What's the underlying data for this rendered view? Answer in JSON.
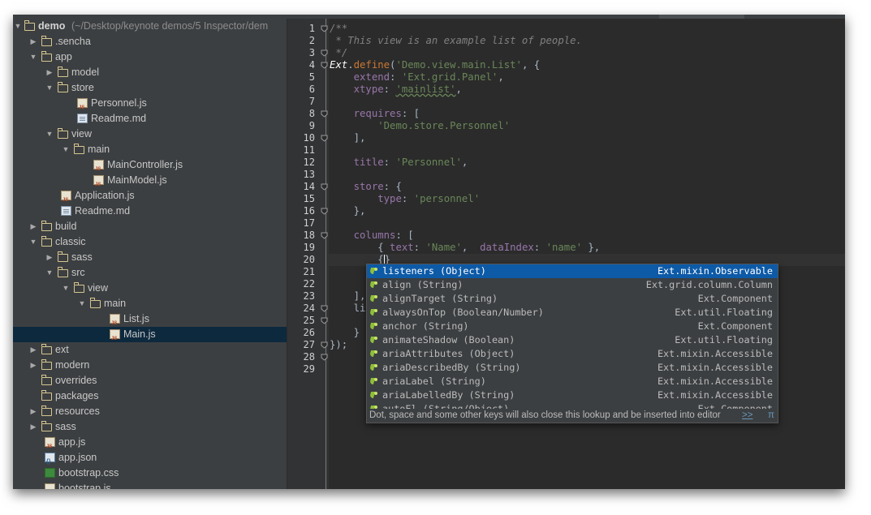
{
  "tree": {
    "root": {
      "name": "demo",
      "path": "(~/Desktop/keynote demos/5 Inspector/dem"
    },
    "items": [
      {
        "label": ".sencha",
        "type": "folder",
        "expanded": false
      },
      {
        "label": "app",
        "type": "folder",
        "expanded": true
      },
      {
        "label": "model",
        "type": "folder",
        "expanded": false
      },
      {
        "label": "store",
        "type": "folder",
        "expanded": true
      },
      {
        "label": "Personnel.js",
        "type": "js"
      },
      {
        "label": "Readme.md",
        "type": "md"
      },
      {
        "label": "view",
        "type": "folder",
        "expanded": true
      },
      {
        "label": "main",
        "type": "folder",
        "expanded": true
      },
      {
        "label": "MainController.js",
        "type": "js"
      },
      {
        "label": "MainModel.js",
        "type": "js"
      },
      {
        "label": "Application.js",
        "type": "js"
      },
      {
        "label": "Readme.md",
        "type": "md"
      },
      {
        "label": "build",
        "type": "folder",
        "expanded": false
      },
      {
        "label": "classic",
        "type": "folder",
        "expanded": true
      },
      {
        "label": "sass",
        "type": "folder",
        "expanded": false
      },
      {
        "label": "src",
        "type": "folder",
        "expanded": true
      },
      {
        "label": "view",
        "type": "folder",
        "expanded": true
      },
      {
        "label": "main",
        "type": "folder",
        "expanded": true
      },
      {
        "label": "List.js",
        "type": "js"
      },
      {
        "label": "Main.js",
        "type": "js",
        "selected": true
      },
      {
        "label": "ext",
        "type": "folder",
        "expanded": false
      },
      {
        "label": "modern",
        "type": "folder",
        "expanded": false
      },
      {
        "label": "overrides",
        "type": "folder"
      },
      {
        "label": "packages",
        "type": "folder"
      },
      {
        "label": "resources",
        "type": "folder",
        "expanded": false
      },
      {
        "label": "sass",
        "type": "folder",
        "expanded": false
      },
      {
        "label": "app.js",
        "type": "js"
      },
      {
        "label": "app.json",
        "type": "json"
      },
      {
        "label": "bootstrap.css",
        "type": "css"
      },
      {
        "label": "bootstrap.js",
        "type": "js"
      }
    ]
  },
  "editor": {
    "line_numbers": [
      "1",
      "2",
      "3",
      "4",
      "5",
      "6",
      "7",
      "8",
      "9",
      "10",
      "11",
      "12",
      "13",
      "14",
      "15",
      "16",
      "17",
      "18",
      "19",
      "20",
      "21",
      "22",
      "23",
      "24",
      "25",
      "26",
      "27",
      "28",
      "29"
    ],
    "code": {
      "l1": "/**",
      "l2": " * This view is an example list of people.",
      "l3": " */",
      "l4_cls": "Ext",
      "l4_dot": ".",
      "l4_fn": "define",
      "l4_open": "(",
      "l4_str": "'Demo.view.main.List'",
      "l4_rest": ", {",
      "l5_key": "extend",
      "l5_str": "'Ext.grid.Panel'",
      "l6_key": "xtype",
      "l6_str": "'mainlist'",
      "l8_key": "requires",
      "l8_rest": ": [",
      "l9_str": "'Demo.store.Personnel'",
      "l10": "],",
      "l12_key": "title",
      "l12_str": "'Personnel'",
      "l14_key": "store",
      "l14_rest": ": {",
      "l15_key": "type",
      "l15_str": "'personnel'",
      "l16": "},",
      "l18_key": "columns",
      "l18_rest": ": [",
      "l19_a": "{ ",
      "l19_k1": "text",
      "l19_s1": "'Name'",
      "l19_k2": "dataIndex",
      "l19_s2": "'name'",
      "l19_end": " },",
      "l20_open": "{",
      "l20_close": "}",
      "l24": "],",
      "l25": "lis",
      "l27": "}",
      "l28": "});"
    }
  },
  "completion": {
    "items": [
      {
        "label": "listeners (Object)",
        "type": "Ext.mixin.Observable",
        "selected": true
      },
      {
        "label": "align (String)",
        "type": "Ext.grid.column.Column"
      },
      {
        "label": "alignTarget (String)",
        "type": "Ext.Component"
      },
      {
        "label": "alwaysOnTop (Boolean/Number)",
        "type": "Ext.util.Floating"
      },
      {
        "label": "anchor (String)",
        "type": "Ext.Component"
      },
      {
        "label": "animateShadow (Boolean)",
        "type": "Ext.util.Floating"
      },
      {
        "label": "ariaAttributes (Object)",
        "type": "Ext.mixin.Accessible"
      },
      {
        "label": "ariaDescribedBy (String)",
        "type": "Ext.mixin.Accessible"
      },
      {
        "label": "ariaLabel (String)",
        "type": "Ext.mixin.Accessible"
      },
      {
        "label": "ariaLabelledBy (String)",
        "type": "Ext.mixin.Accessible"
      },
      {
        "label": "autoEl (String/Object)",
        "type": "Ext.Component"
      }
    ],
    "footer_hint": "Dot, space and some other keys will also close this lookup and be inserted into editor",
    "footer_more": ">>",
    "footer_pi": "π"
  },
  "colors": {
    "tree_bg": "#3c3f41",
    "editor_bg": "#2b2b2b",
    "selection": "#0d5aa7",
    "keyword": "#cc7832",
    "string": "#6a8759",
    "property": "#9876aa"
  }
}
